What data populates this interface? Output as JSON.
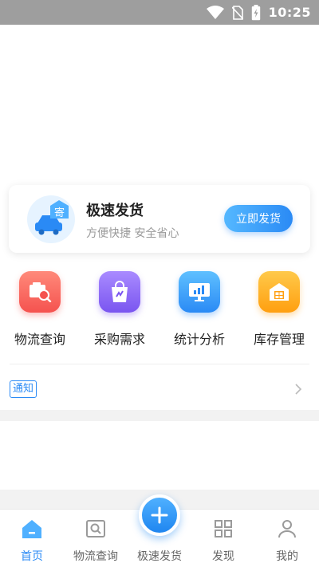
{
  "status_bar": {
    "time": "10:25"
  },
  "ship_card": {
    "icon_text": "寄",
    "title": "极速发货",
    "subtitle": "方便快捷 安全省心",
    "button": "立即发货"
  },
  "quick_menu": [
    {
      "label": "物流查询",
      "icon": "logistics-search-icon",
      "color": "#ff6b6b"
    },
    {
      "label": "采购需求",
      "icon": "shopping-bag-icon",
      "color": "#8e6bff"
    },
    {
      "label": "统计分析",
      "icon": "statistics-chart-icon",
      "color": "#3aa6ff"
    },
    {
      "label": "库存管理",
      "icon": "warehouse-icon",
      "color": "#ffb020"
    }
  ],
  "notice": {
    "tag": "通知"
  },
  "tab_bar": {
    "items": [
      {
        "label": "首页",
        "icon": "home-icon",
        "active": true
      },
      {
        "label": "物流查询",
        "icon": "search-box-icon",
        "active": false
      },
      {
        "label": "极速发货",
        "icon": "plus-icon",
        "active": false
      },
      {
        "label": "发现",
        "icon": "grid-icon",
        "active": false
      },
      {
        "label": "我的",
        "icon": "user-icon",
        "active": false
      }
    ],
    "accent": "#2a8af5"
  }
}
